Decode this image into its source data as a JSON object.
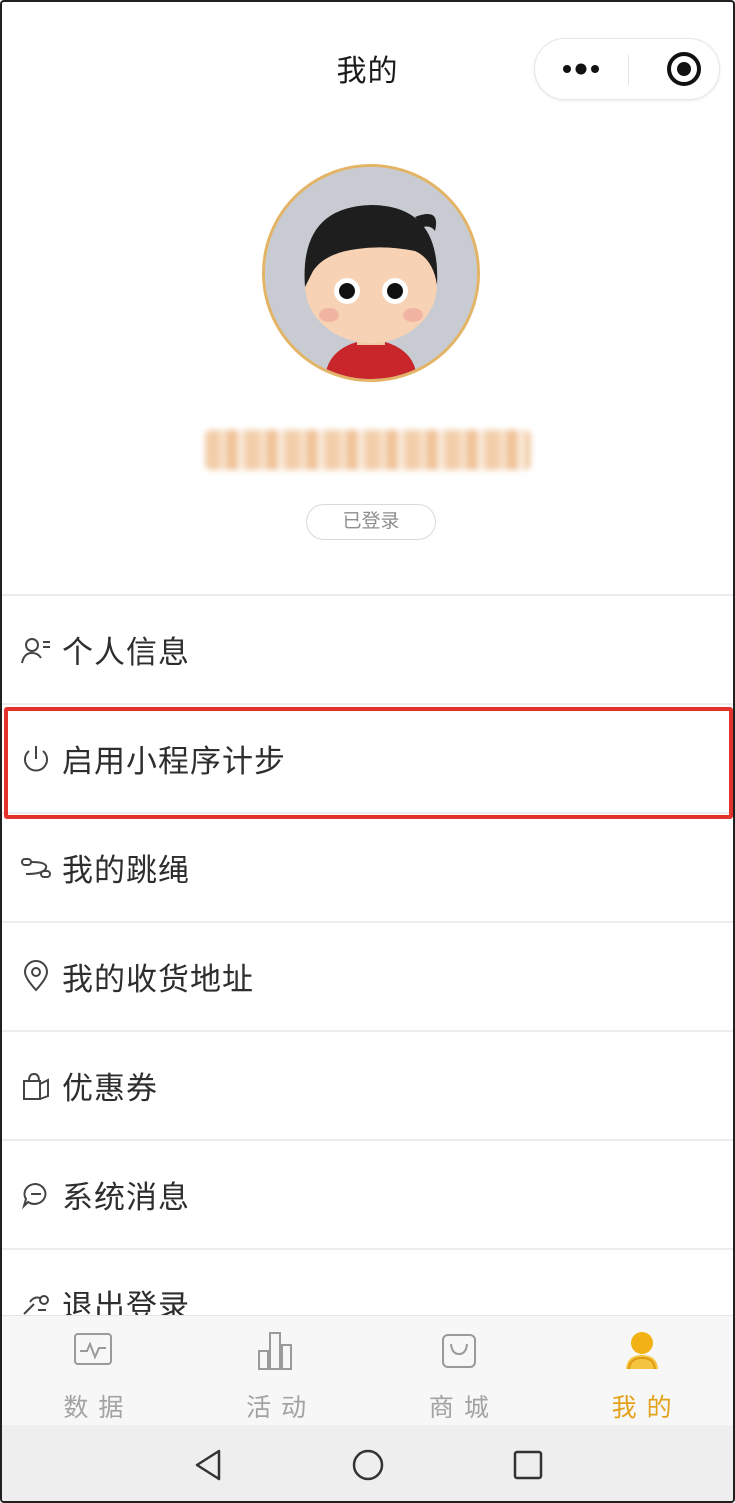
{
  "header": {
    "title": "我的",
    "more_icon": "more-dots-icon",
    "target_icon": "target-icon"
  },
  "profile": {
    "avatar_icon": "cartoon-avatar",
    "login_status": "已登录"
  },
  "menu": {
    "items": [
      {
        "label": "个人信息",
        "icon": "person-info-icon"
      },
      {
        "label": "启用小程序计步",
        "icon": "power-icon",
        "highlighted": true
      },
      {
        "label": "我的跳绳",
        "icon": "jump-rope-icon"
      },
      {
        "label": "我的收货地址",
        "icon": "location-pin-icon"
      },
      {
        "label": "优惠券",
        "icon": "coupon-bag-icon"
      },
      {
        "label": "系统消息",
        "icon": "message-bubble-icon"
      },
      {
        "label": "退出登录",
        "icon": "logout-icon"
      }
    ]
  },
  "tabbar": {
    "tabs": [
      {
        "label": "数据",
        "icon": "data-chart-icon",
        "active": false
      },
      {
        "label": "活动",
        "icon": "activity-bars-icon",
        "active": false
      },
      {
        "label": "商城",
        "icon": "shop-bag-icon",
        "active": false
      },
      {
        "label": "我的",
        "icon": "profile-icon",
        "active": true
      }
    ]
  },
  "colors": {
    "accent": "#e2a21a",
    "highlight_border": "#e2322b",
    "text": "#2e2e2e",
    "muted": "#a3a3a3"
  }
}
